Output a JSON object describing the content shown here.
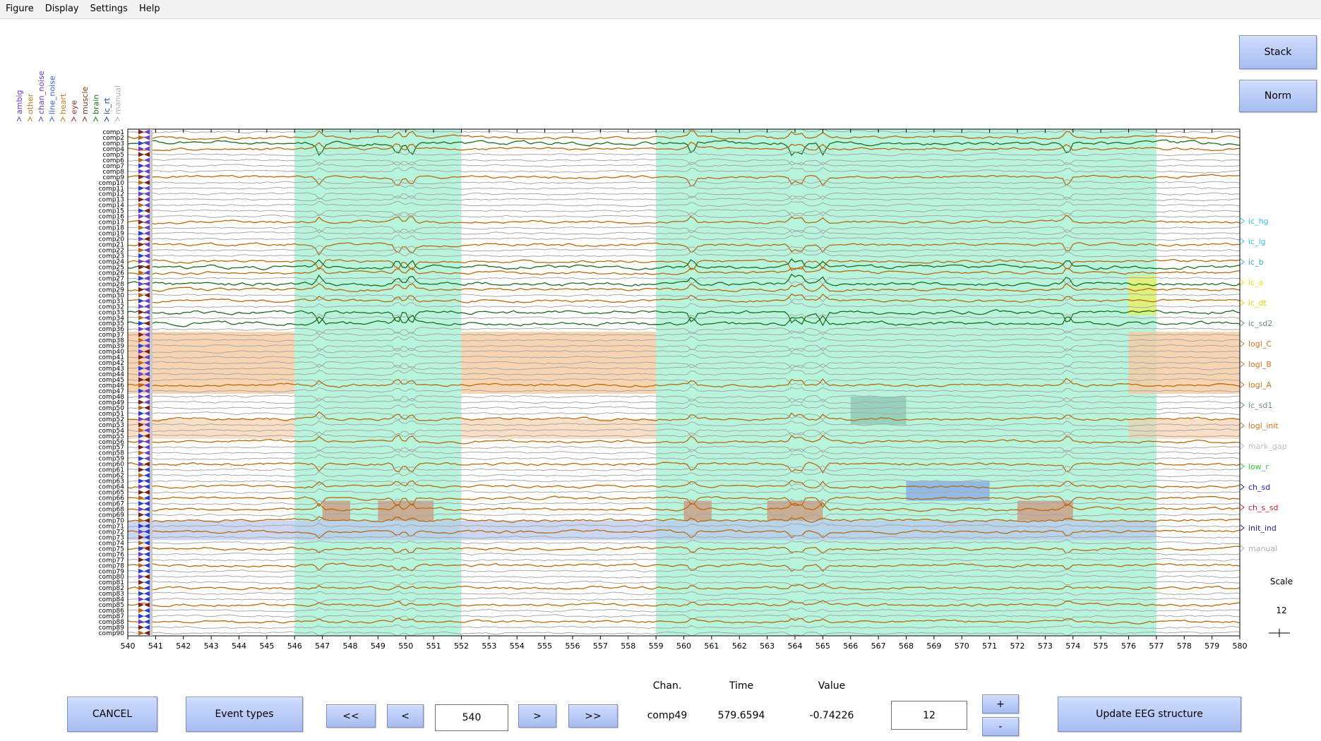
{
  "menubar": {
    "items": [
      "Figure",
      "Display",
      "Settings",
      "Help"
    ]
  },
  "buttons": {
    "stack": "Stack",
    "norm": "Norm",
    "cancel": "CANCEL",
    "event_types": "Event types",
    "first": "<<",
    "prev": "<",
    "next": ">",
    "last": ">>",
    "scale_up": "+",
    "scale_down": "-",
    "update": "Update EEG structure"
  },
  "inputs": {
    "position": "540",
    "scale": "12"
  },
  "readout": {
    "chan_label": "Chan.",
    "time_label": "Time",
    "value_label": "Value",
    "chan": "comp49",
    "time": "579.6594",
    "value": "-0.74226"
  },
  "scale_panel": {
    "label": "Scale",
    "value": "12"
  },
  "legend_top": [
    {
      "label": "ambig",
      "color": "#6a3fd0"
    },
    {
      "label": "other",
      "color": "#c77b20"
    },
    {
      "label": "chan_noise",
      "color": "#6a3fd0"
    },
    {
      "label": "line_noise",
      "color": "#3366dd"
    },
    {
      "label": "heart",
      "color": "#c77b20"
    },
    {
      "label": "eye",
      "color": "#aa2222"
    },
    {
      "label": "muscle",
      "color": "#7a3b1a"
    },
    {
      "label": "brain",
      "color": "#1c7a1c"
    },
    {
      "label": "ic_rt",
      "color": "#2244aa"
    },
    {
      "label": "manual",
      "color": "#b0b0b0"
    }
  ],
  "legend_right": [
    {
      "label": "ic_hg",
      "color": "#33c8e0"
    },
    {
      "label": "ic_lg",
      "color": "#33c8e0"
    },
    {
      "label": "ic_b",
      "color": "#33b0e0"
    },
    {
      "label": "ic_a",
      "color": "#e6e600"
    },
    {
      "label": "ic_dt",
      "color": "#d8d800"
    },
    {
      "label": "ic_sd2",
      "color": "#6b8e8e"
    },
    {
      "label": "logl_C",
      "color": "#e07020"
    },
    {
      "label": "logl_B",
      "color": "#e07020"
    },
    {
      "label": "logl_A",
      "color": "#e07020"
    },
    {
      "label": "ic_sd1",
      "color": "#6b8e8e"
    },
    {
      "label": "logl_init",
      "color": "#e07020"
    },
    {
      "label": "mark_gap",
      "color": "#c0c0c0"
    },
    {
      "label": "low_r",
      "color": "#33cc33"
    },
    {
      "label": "ch_sd",
      "color": "#2222cc"
    },
    {
      "label": "ch_s_sd",
      "color": "#cc2222"
    },
    {
      "label": "init_ind",
      "color": "#2222aa"
    },
    {
      "label": "manual",
      "color": "#b0b0b0"
    }
  ],
  "xaxis": {
    "ticks": [
      "540",
      "541",
      "542",
      "543",
      "544",
      "545",
      "546",
      "547",
      "548",
      "549",
      "550",
      "551",
      "552",
      "553",
      "554",
      "555",
      "556",
      "557",
      "558",
      "559",
      "560",
      "561",
      "562",
      "563",
      "564",
      "565",
      "566",
      "567",
      "568",
      "569",
      "570",
      "571",
      "572",
      "573",
      "574",
      "575",
      "576",
      "577",
      "578",
      "579",
      "580"
    ]
  },
  "channels": {
    "prefix": "comp",
    "count": 90,
    "visible_labels_sample": [
      "comp1",
      "comp2",
      "comp3",
      "comp10",
      "comp20",
      "comp30",
      "comp40",
      "comp50",
      "comp60",
      "comp70",
      "comp80",
      "comp90"
    ]
  },
  "colors": {
    "button_top": "#cfdcff",
    "button_bottom": "#a7bdf0",
    "mark_window": "#9ff0d0",
    "logl_band": "#f7c9a0",
    "init_band": "#b7c6f0",
    "trace_gray": "#a8a8a8",
    "trace_orange": "#b86a12",
    "trace_green": "#1f6b1f"
  }
}
